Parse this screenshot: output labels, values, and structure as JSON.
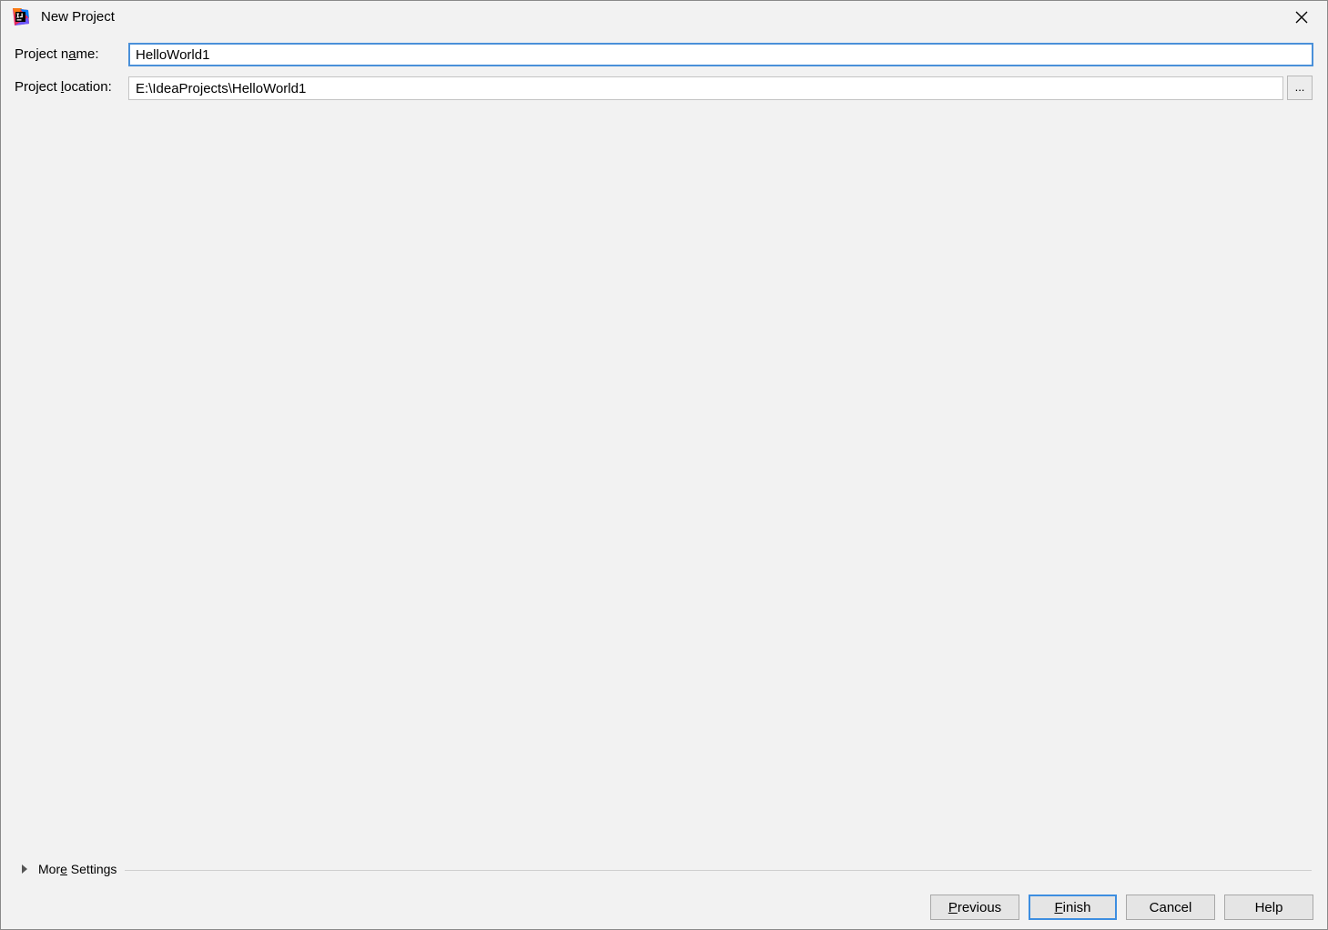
{
  "window": {
    "title": "New Project"
  },
  "form": {
    "project_name_label_pre": "Project n",
    "project_name_label_mn": "a",
    "project_name_label_post": "me:",
    "project_name_value": "HelloWorld1",
    "project_location_label_pre": "Project ",
    "project_location_label_mn": "l",
    "project_location_label_post": "ocation:",
    "project_location_value": "E:\\IdeaProjects\\HelloWorld1",
    "browse_label": "..."
  },
  "more_settings": {
    "label_pre": "Mor",
    "label_mn": "e",
    "label_post": " Settings"
  },
  "buttons": {
    "previous_mn": "P",
    "previous_rest": "revious",
    "finish_mn": "F",
    "finish_rest": "inish",
    "cancel": "Cancel",
    "help": "Help"
  },
  "colors": {
    "accent": "#3d8ee0",
    "background": "#f2f2f2"
  }
}
